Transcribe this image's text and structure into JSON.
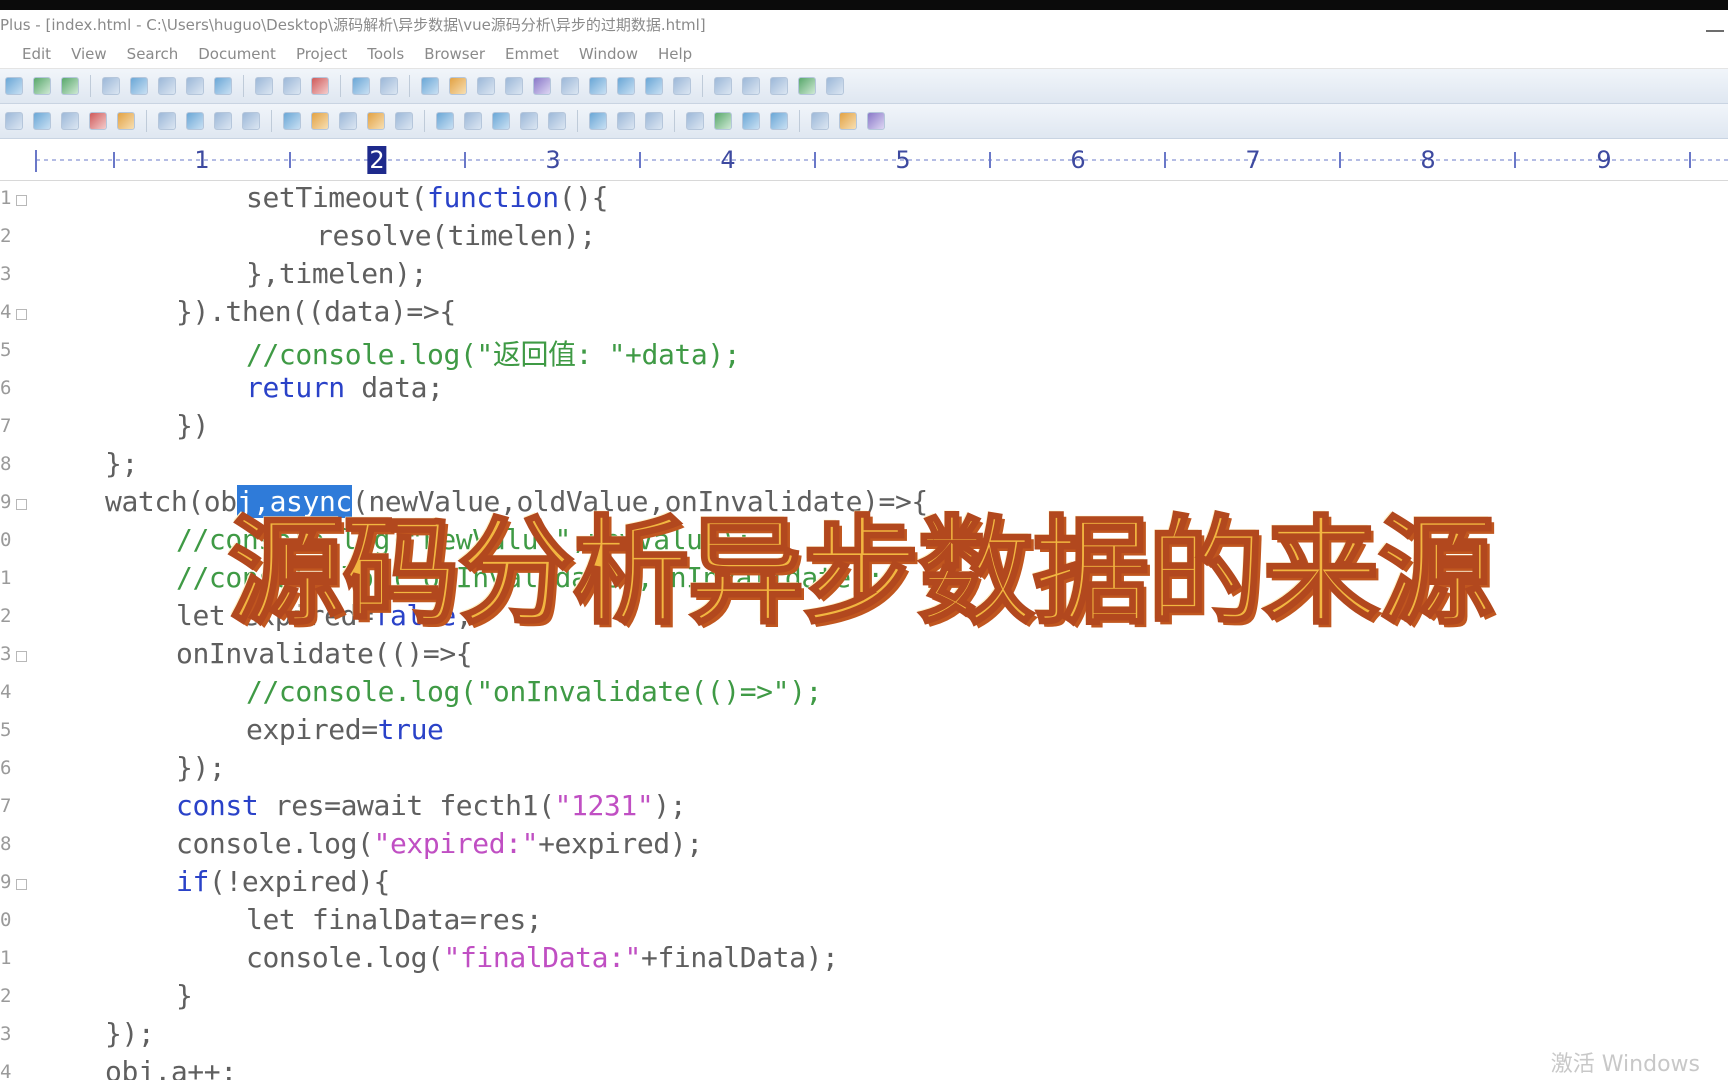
{
  "window": {
    "title": "Plus - [index.html - C:\\Users\\huguo\\Desktop\\源码解析\\异步数据\\vue源码分析\\异步的过期数据.html]"
  },
  "menu": [
    "Edit",
    "View",
    "Search",
    "Document",
    "Project",
    "Tools",
    "Browser",
    "Emmet",
    "Window",
    "Help"
  ],
  "ruler": {
    "numbers": [
      "1",
      "2",
      "3",
      "4",
      "5",
      "6",
      "7",
      "8",
      "9"
    ],
    "active": "2"
  },
  "gutter": [
    "1",
    "2",
    "3",
    "4",
    "5",
    "6",
    "7",
    "8",
    "9",
    "0",
    "1",
    "2",
    "3",
    "4",
    "5",
    "6",
    "7",
    "8",
    "9",
    "0",
    "1",
    "2",
    "3",
    "4"
  ],
  "code": [
    [
      {
        "t": "setTimeout("
      },
      {
        "t": "function",
        "c": "k"
      },
      {
        "t": "(){"
      }
    ],
    [
      {
        "t": "resolve(timelen);"
      }
    ],
    [
      {
        "t": "},timelen);"
      }
    ],
    [
      {
        "t": "}).then((data)=>{"
      }
    ],
    [
      {
        "t": "//console.log(\"返回值: \"+data);",
        "c": "c"
      }
    ],
    [
      {
        "t": "return",
        "c": "k"
      },
      {
        "t": " data;"
      }
    ],
    [
      {
        "t": "})"
      }
    ],
    [
      {
        "t": "};"
      }
    ],
    [
      {
        "t": "watch(ob"
      },
      {
        "t": "j,async",
        "c": "sel"
      },
      {
        "t": "(newValue,oldValue,onInvalidate)=>{"
      }
    ],
    [
      {
        "t": "//console.log(\"newValue\",newValue);",
        "c": "c"
      }
    ],
    [
      {
        "t": "//console.log(\"onInvalidate\",onInvalidate);",
        "c": "c"
      }
    ],
    [
      {
        "t": "let expired="
      },
      {
        "t": "false",
        "c": "k"
      },
      {
        "t": ";"
      }
    ],
    [
      {
        "t": "onInvalidate(()=>{"
      }
    ],
    [
      {
        "t": "//console.log(\"onInvalidate(()=>\");",
        "c": "c"
      }
    ],
    [
      {
        "t": "expired="
      },
      {
        "t": "true",
        "c": "k"
      }
    ],
    [
      {
        "t": "});"
      }
    ],
    [
      {
        "t": "const",
        "c": "k"
      },
      {
        "t": " res=await fecth1("
      },
      {
        "t": "\"1231\"",
        "c": "s"
      },
      {
        "t": ");"
      }
    ],
    [
      {
        "t": "console.log("
      },
      {
        "t": "\"expired:\"",
        "c": "s"
      },
      {
        "t": "+expired);"
      }
    ],
    [
      {
        "t": "if",
        "c": "k"
      },
      {
        "t": "(!expired){"
      }
    ],
    [
      {
        "t": "let finalData=res;"
      }
    ],
    [
      {
        "t": "console.log("
      },
      {
        "t": "\"finalData:\"",
        "c": "s"
      },
      {
        "t": "+finalData);"
      }
    ],
    [
      {
        "t": "}"
      }
    ],
    [
      {
        "t": "});"
      }
    ],
    [
      {
        "t": "obj.a++;"
      }
    ]
  ],
  "overlay": {
    "title": "源码分析异步数据的来源"
  },
  "watermark": "激活 Windows"
}
